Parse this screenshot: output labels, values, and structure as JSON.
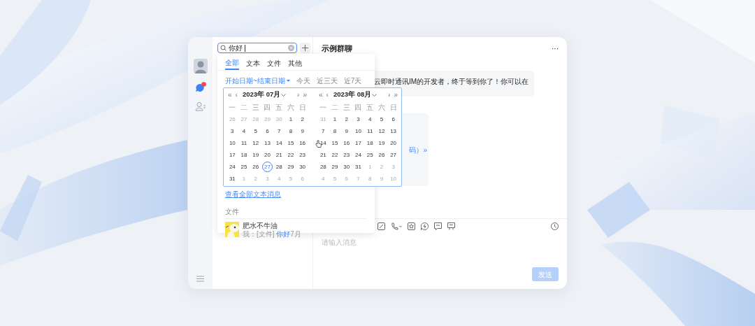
{
  "rail": {
    "items": [
      {
        "kind": "avatar"
      },
      {
        "kind": "chat",
        "selected": true,
        "badge": true
      },
      {
        "kind": "contacts",
        "selected": false
      }
    ]
  },
  "search": {
    "value": "你好"
  },
  "search_popup": {
    "tabs": [
      {
        "label": "全部",
        "selected": true
      },
      {
        "label": "文本",
        "selected": false
      },
      {
        "label": "文件",
        "selected": false
      },
      {
        "label": "其他",
        "selected": false
      }
    ],
    "date_filters": [
      {
        "label": "开始日期~结束日期",
        "selected": true
      },
      {
        "label": "今天",
        "selected": false
      },
      {
        "label": "近三天",
        "selected": false
      },
      {
        "label": "近7天",
        "selected": false
      }
    ],
    "calendar": {
      "months": [
        {
          "title": "2023年 07月",
          "nav_prev": [
            "«",
            "‹"
          ],
          "nav_next": [
            "›",
            "»"
          ],
          "weekdays": [
            "一",
            "二",
            "三",
            "四",
            "五",
            "六",
            "日"
          ],
          "weeks": [
            [
              {
                "d": "26",
                "muted": true,
                "selected": false
              },
              {
                "d": "27",
                "muted": true,
                "selected": false
              },
              {
                "d": "28",
                "muted": true,
                "selected": false
              },
              {
                "d": "29",
                "muted": true,
                "selected": false
              },
              {
                "d": "30",
                "muted": true,
                "selected": false
              },
              {
                "d": "1",
                "muted": false,
                "selected": false
              },
              {
                "d": "2",
                "muted": false,
                "selected": false
              }
            ],
            [
              {
                "d": "3",
                "muted": false,
                "selected": false
              },
              {
                "d": "4",
                "muted": false,
                "selected": false
              },
              {
                "d": "5",
                "muted": false,
                "selected": false
              },
              {
                "d": "6",
                "muted": false,
                "selected": false
              },
              {
                "d": "7",
                "muted": false,
                "selected": false
              },
              {
                "d": "8",
                "muted": false,
                "selected": false
              },
              {
                "d": "9",
                "muted": false,
                "selected": false
              }
            ],
            [
              {
                "d": "10",
                "muted": false,
                "selected": false
              },
              {
                "d": "11",
                "muted": false,
                "selected": false
              },
              {
                "d": "12",
                "muted": false,
                "selected": false
              },
              {
                "d": "13",
                "muted": false,
                "selected": false
              },
              {
                "d": "14",
                "muted": false,
                "selected": false
              },
              {
                "d": "15",
                "muted": false,
                "selected": false
              },
              {
                "d": "16",
                "muted": false,
                "selected": false
              }
            ],
            [
              {
                "d": "17",
                "muted": false,
                "selected": false
              },
              {
                "d": "18",
                "muted": false,
                "selected": false
              },
              {
                "d": "19",
                "muted": false,
                "selected": false
              },
              {
                "d": "20",
                "muted": false,
                "selected": false
              },
              {
                "d": "21",
                "muted": false,
                "selected": false
              },
              {
                "d": "22",
                "muted": false,
                "selected": false
              },
              {
                "d": "23",
                "muted": false,
                "selected": false
              }
            ],
            [
              {
                "d": "24",
                "muted": false,
                "selected": false
              },
              {
                "d": "25",
                "muted": false,
                "selected": false
              },
              {
                "d": "26",
                "muted": false,
                "selected": false
              },
              {
                "d": "27",
                "muted": false,
                "selected": true
              },
              {
                "d": "28",
                "muted": false,
                "selected": false
              },
              {
                "d": "29",
                "muted": false,
                "selected": false
              },
              {
                "d": "30",
                "muted": false,
                "selected": false
              }
            ],
            [
              {
                "d": "31",
                "muted": false,
                "selected": false
              },
              {
                "d": "1",
                "muted": true,
                "selected": false
              },
              {
                "d": "2",
                "muted": true,
                "selected": false
              },
              {
                "d": "3",
                "muted": true,
                "selected": false
              },
              {
                "d": "4",
                "muted": true,
                "selected": false
              },
              {
                "d": "5",
                "muted": true,
                "selected": false
              },
              {
                "d": "6",
                "muted": true,
                "selected": false
              }
            ]
          ]
        },
        {
          "title": "2023年 08月",
          "nav_prev": [
            "«",
            "‹"
          ],
          "nav_next": [
            "›",
            "»"
          ],
          "weekdays": [
            "一",
            "二",
            "三",
            "四",
            "五",
            "六",
            "日"
          ],
          "weeks": [
            [
              {
                "d": "31",
                "muted": true,
                "selected": false
              },
              {
                "d": "1",
                "muted": false,
                "selected": false
              },
              {
                "d": "2",
                "muted": false,
                "selected": false
              },
              {
                "d": "3",
                "muted": false,
                "selected": false
              },
              {
                "d": "4",
                "muted": false,
                "selected": false
              },
              {
                "d": "5",
                "muted": false,
                "selected": false
              },
              {
                "d": "6",
                "muted": false,
                "selected": false
              }
            ],
            [
              {
                "d": "7",
                "muted": false,
                "selected": false
              },
              {
                "d": "8",
                "muted": false,
                "selected": false
              },
              {
                "d": "9",
                "muted": false,
                "selected": false
              },
              {
                "d": "10",
                "muted": false,
                "selected": false
              },
              {
                "d": "11",
                "muted": false,
                "selected": false
              },
              {
                "d": "12",
                "muted": false,
                "selected": false
              },
              {
                "d": "13",
                "muted": false,
                "selected": false
              }
            ],
            [
              {
                "d": "14",
                "muted": false,
                "selected": false
              },
              {
                "d": "15",
                "muted": false,
                "selected": false
              },
              {
                "d": "16",
                "muted": false,
                "selected": false
              },
              {
                "d": "17",
                "muted": false,
                "selected": false
              },
              {
                "d": "18",
                "muted": false,
                "selected": false
              },
              {
                "d": "19",
                "muted": false,
                "selected": false
              },
              {
                "d": "20",
                "muted": false,
                "selected": false
              }
            ],
            [
              {
                "d": "21",
                "muted": false,
                "selected": false
              },
              {
                "d": "22",
                "muted": false,
                "selected": false
              },
              {
                "d": "23",
                "muted": false,
                "selected": false
              },
              {
                "d": "24",
                "muted": false,
                "selected": false
              },
              {
                "d": "25",
                "muted": false,
                "selected": false
              },
              {
                "d": "26",
                "muted": false,
                "selected": false
              },
              {
                "d": "27",
                "muted": false,
                "selected": false
              }
            ],
            [
              {
                "d": "28",
                "muted": false,
                "selected": false
              },
              {
                "d": "29",
                "muted": false,
                "selected": false
              },
              {
                "d": "30",
                "muted": false,
                "selected": false
              },
              {
                "d": "31",
                "muted": false,
                "selected": false
              },
              {
                "d": "1",
                "muted": true,
                "selected": false
              },
              {
                "d": "2",
                "muted": true,
                "selected": false
              },
              {
                "d": "3",
                "muted": true,
                "selected": false
              }
            ],
            [
              {
                "d": "4",
                "muted": true,
                "selected": false
              },
              {
                "d": "5",
                "muted": true,
                "selected": false
              },
              {
                "d": "6",
                "muted": true,
                "selected": false
              },
              {
                "d": "7",
                "muted": true,
                "selected": false
              },
              {
                "d": "8",
                "muted": true,
                "selected": false
              },
              {
                "d": "9",
                "muted": true,
                "selected": false
              },
              {
                "d": "10",
                "muted": true,
                "selected": false
              }
            ]
          ]
        }
      ]
    },
    "view_all_link": "查看全部文本消息",
    "file_section": {
      "title": "文件",
      "items": [
        {
          "name": "肥水不牛油",
          "meta": [
            {
              "text": "我：[文件] ",
              "highlight": false
            },
            {
              "text": "你好",
              "highlight": true
            },
            {
              "text": "7月",
              "highlight": false
            }
          ]
        }
      ]
    }
  },
  "chat": {
    "title": "示例群聊",
    "more": "···",
    "messages": [
      {
        "kind": "bubble",
        "text": "云即时通讯IM的开发者，终于等到你了！你可以在"
      },
      {
        "kind": "card",
        "text": "码）»"
      }
    ],
    "toolbar": [
      {
        "kind": "edit"
      },
      {
        "kind": "phone"
      },
      {
        "kind": "star"
      },
      {
        "kind": "bolt"
      },
      {
        "kind": "message"
      },
      {
        "kind": "board"
      },
      {
        "kind": "clock"
      }
    ],
    "input": {
      "placeholder": "请输入消息"
    },
    "send_button": {
      "label": "发送",
      "disabled": true
    }
  }
}
